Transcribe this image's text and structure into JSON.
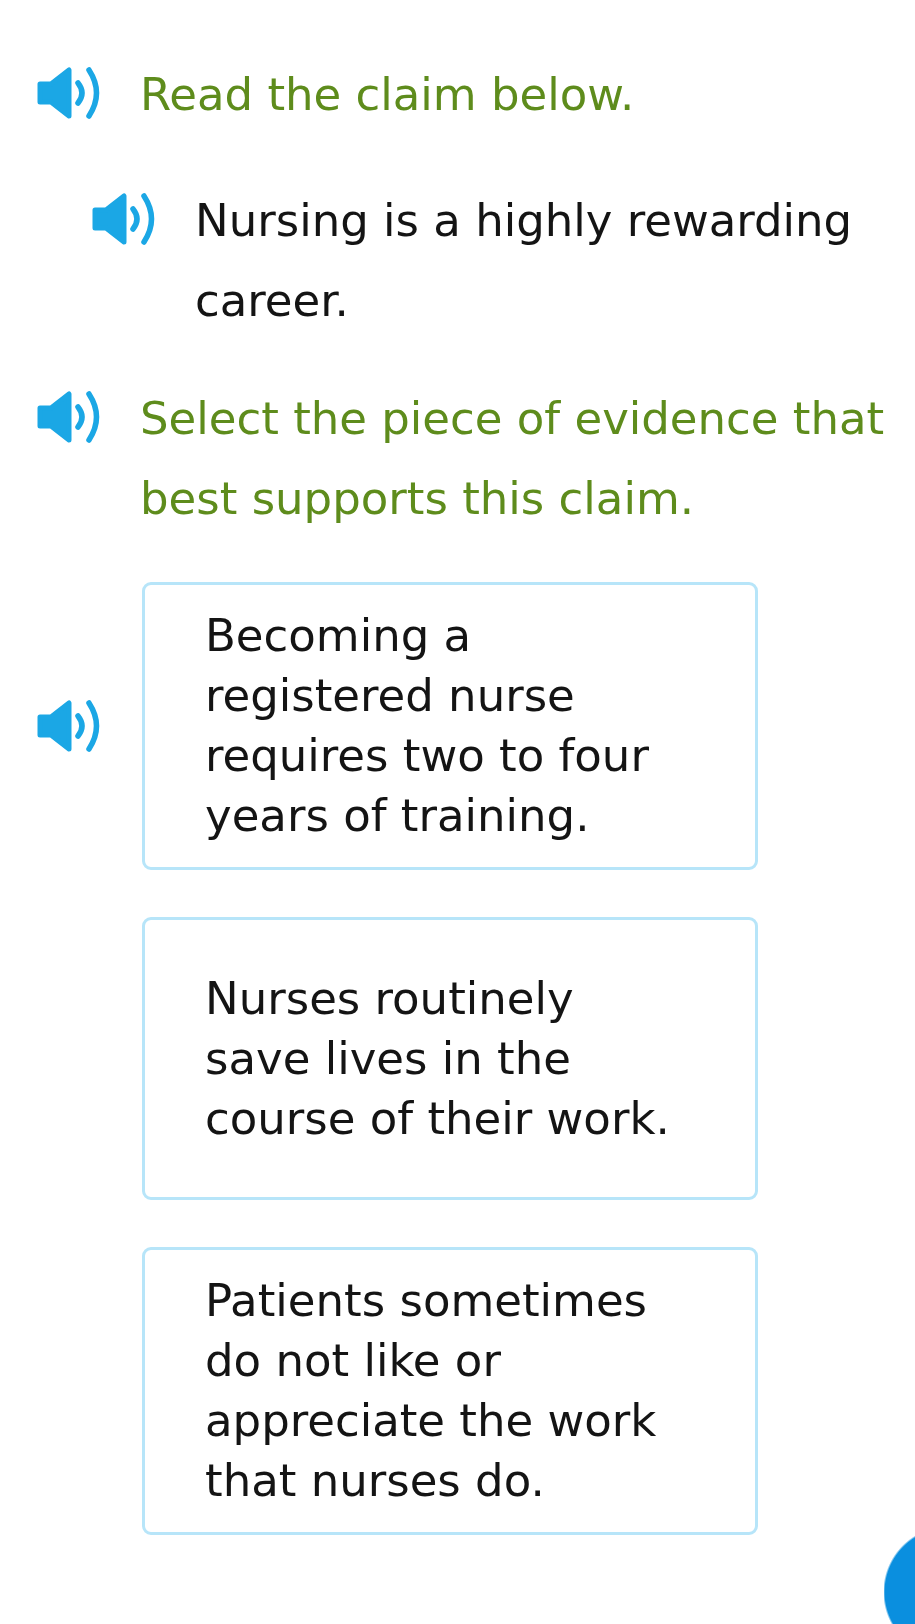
{
  "prompt": {
    "text": "Read the claim below."
  },
  "claim": {
    "text": "Nursing is a highly rewarding career."
  },
  "question": {
    "text": "Select the piece of evidence that best supports this claim."
  },
  "options": [
    {
      "text": "Becoming a registered nurse requires two to four years of training.",
      "speaker_shown": true,
      "selected": false
    },
    {
      "text": "Nurses routinely save lives in the course of their work.",
      "speaker_shown": false,
      "selected": false
    },
    {
      "text": "Patients sometimes do not like or appreciate the work that nurses do.",
      "speaker_shown": false,
      "selected": false
    }
  ]
}
